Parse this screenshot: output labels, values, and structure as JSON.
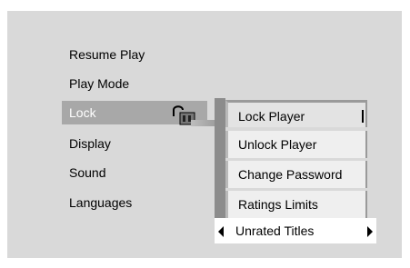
{
  "menu": {
    "items": [
      {
        "label": "Resume Play"
      },
      {
        "label": "Play Mode"
      },
      {
        "label": "Lock"
      },
      {
        "label": "Display"
      },
      {
        "label": "Sound"
      },
      {
        "label": "Languages"
      }
    ],
    "selected_index": 2
  },
  "lock_submenu": {
    "items": [
      {
        "label": "Lock Player"
      },
      {
        "label": "Unlock Player"
      },
      {
        "label": "Change Password"
      },
      {
        "label": "Ratings Limits"
      },
      {
        "label": "Unrated Titles"
      }
    ]
  },
  "colors": {
    "background": "#d9d9d9",
    "selected": "#a8a8a8",
    "submenu": "#efefef",
    "rail": "#8c8c8c"
  },
  "icons": {
    "lock": "open-lock-icon",
    "left_arrow": "left-arrow-icon",
    "right_arrow": "right-arrow-icon"
  }
}
